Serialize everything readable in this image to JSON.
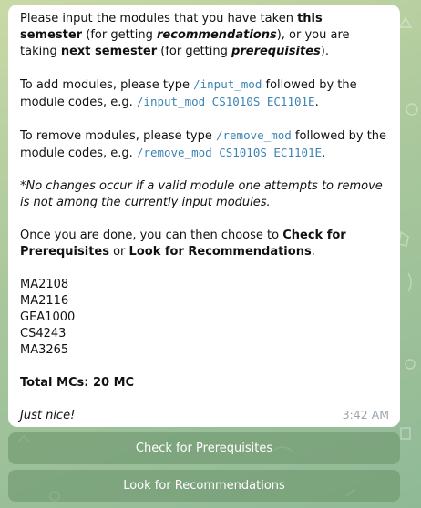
{
  "message": {
    "line1": {
      "a": "Please input the modules that you have taken ",
      "b": "this semester",
      "c": " (for getting ",
      "d": "recommendations",
      "e": "), or you are taking ",
      "f": "next semester",
      "g": " (for getting ",
      "h": "prerequisites",
      "i": ")."
    },
    "add": {
      "a": "To add modules, please type ",
      "cmd": "/input_mod",
      "b": " followed by the module codes, e.g. ",
      "example": "/input_mod CS1010S EC1101E",
      "c": "."
    },
    "remove": {
      "a": "To remove modules, please type ",
      "cmd": "/remove_mod",
      "b": " followed by the module codes, e.g. ",
      "example": "/remove_mod CS1010S EC1101E",
      "c": "."
    },
    "note": "*No changes occur if a valid module one attempts to remove is not among the currently input modules.",
    "done": {
      "a": "Once you are done, you can then choose to ",
      "b": "Check for Prerequisites",
      "c": " or ",
      "d": "Look for Recommendations",
      "e": "."
    },
    "modules": [
      "MA2108",
      "MA2116",
      "GEA1000",
      "CS4243",
      "MA3265"
    ],
    "total": "Total MCs: 20 MC",
    "comment": "Just nice!",
    "time": "3:42 AM"
  },
  "keyboard": {
    "btn1": "Check for Prerequisites",
    "btn2": "Look for Recommendations"
  },
  "colors": {
    "command": "#3d84b5",
    "button_bg": "#6e966e",
    "bubble": "#ffffff"
  }
}
